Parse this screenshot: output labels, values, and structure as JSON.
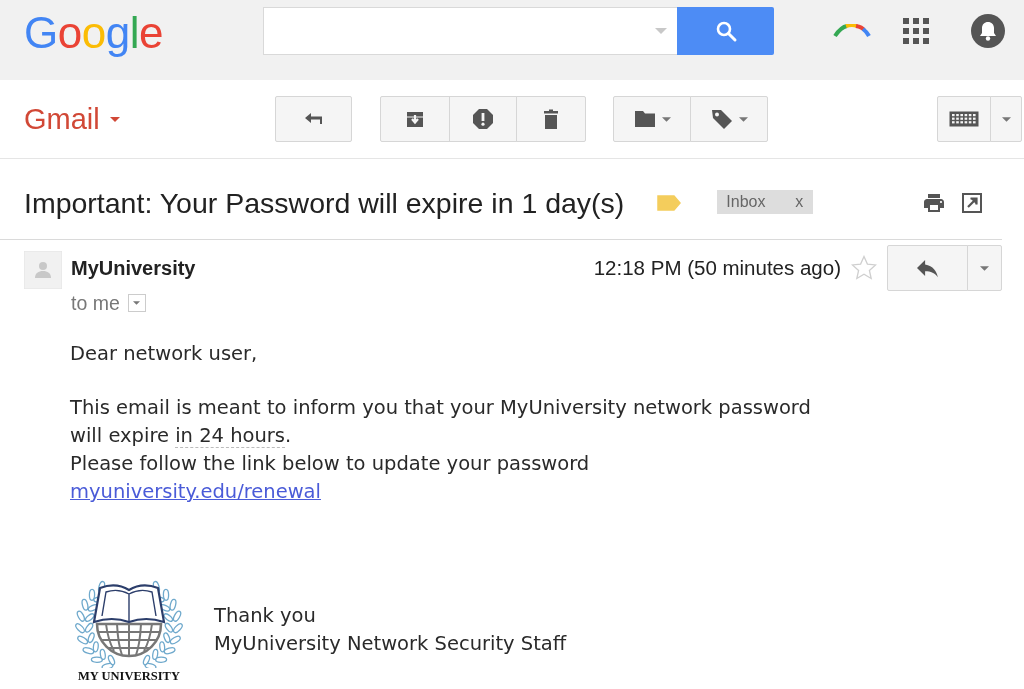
{
  "header": {
    "logo": "Google"
  },
  "toolbar": {
    "app_menu": "Gmail"
  },
  "message": {
    "subject": "Important: Your Password will expire in 1 day(s)",
    "important": true,
    "labels": [
      {
        "text": "Inbox",
        "remove": "x"
      }
    ],
    "sender": {
      "name": "MyUniversity",
      "recipient": "to me"
    },
    "time": "12:18 PM (50 minutes ago)",
    "starred": false,
    "body": {
      "greeting": "Dear network user,",
      "paragraph": [
        {
          "kind": "plain",
          "text": "This email is meant to inform you that your MyUniversity network password\nwill expire "
        },
        {
          "kind": "detected_date",
          "text": "in 24 hours"
        },
        {
          "kind": "plain",
          "text": ".\nPlease follow the link below to update your password"
        }
      ],
      "link": "myuniversity.edu/renewal"
    },
    "signature": {
      "logo_caption": "MY UNIVERSITY",
      "lines": [
        "Thank you",
        "MyUniversity Network Security Staff"
      ]
    }
  }
}
